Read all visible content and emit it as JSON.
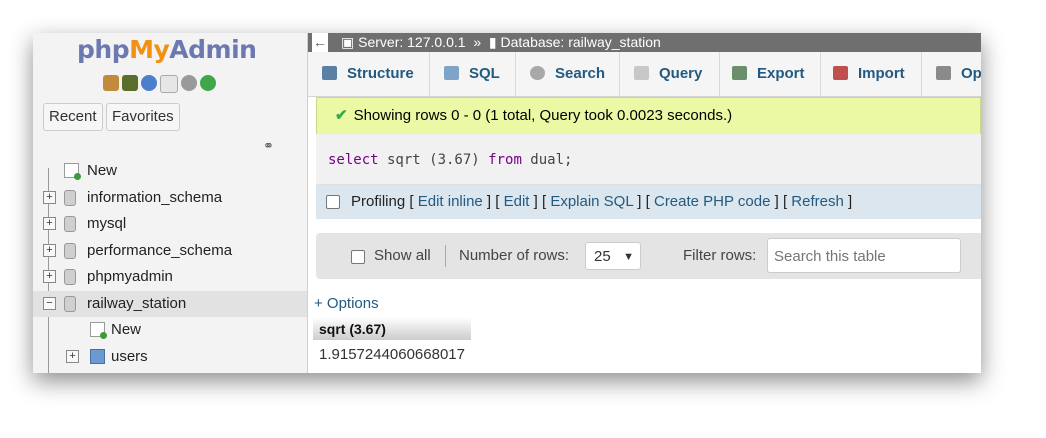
{
  "sidebar": {
    "logo": {
      "php": "php",
      "my": "My",
      "admin": "Admin"
    },
    "icons": [
      "home-icon",
      "table-icon",
      "help-icon",
      "documentation-icon",
      "settings-icon",
      "reload-icon"
    ],
    "recent_label": "Recent",
    "favorites_label": "Favorites",
    "link_icon": "link-icon",
    "tree": [
      {
        "label": "New"
      },
      {
        "label": "information_schema"
      },
      {
        "label": "mysql"
      },
      {
        "label": "performance_schema"
      },
      {
        "label": "phpmyadmin"
      },
      {
        "label": "railway_station"
      },
      {
        "label": "New"
      },
      {
        "label": "users"
      }
    ]
  },
  "breadcrumb": {
    "back": "←",
    "server": "Server: 127.0.0.1",
    "separator": "»",
    "database": "Database: railway_station"
  },
  "tabs": [
    {
      "label": "Structure"
    },
    {
      "label": "SQL"
    },
    {
      "label": "Search"
    },
    {
      "label": "Query"
    },
    {
      "label": "Export"
    },
    {
      "label": "Import"
    },
    {
      "label": "Op"
    }
  ],
  "message": {
    "check": "✔",
    "text": "Showing rows 0 - 0 (1 total, Query took 0.0023 seconds.)"
  },
  "sql": {
    "kw1": "select",
    "mid": " sqrt (3.67) ",
    "kw2": "from",
    "end": " dual;"
  },
  "profiling": {
    "label": "Profiling",
    "links": [
      "Edit inline",
      "Edit",
      "Explain SQL",
      "Create PHP code",
      "Refresh"
    ]
  },
  "controls": {
    "show_all": "Show all",
    "number_of_rows": "Number of rows:",
    "rows_value": "25",
    "filter_rows": "Filter rows:",
    "search_placeholder": "Search this table"
  },
  "options_link": "+ Options",
  "result": {
    "header": "sqrt (3.67)",
    "value": "1.9157244060668017"
  },
  "colors": {
    "accent": "#235a81",
    "success_bg": "#ebf8a4",
    "logo_orange": "#f29111",
    "logo_blue": "#6c78af"
  }
}
